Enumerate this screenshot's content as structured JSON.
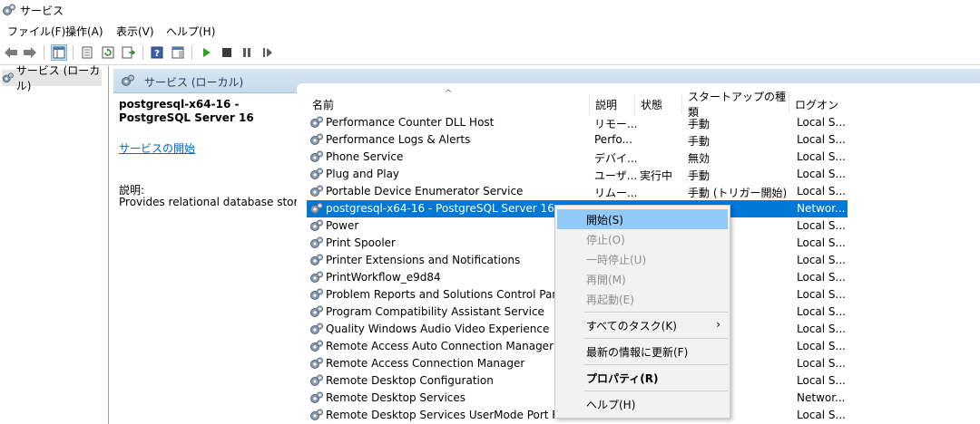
{
  "window": {
    "title": "サービス"
  },
  "menu": [
    {
      "label": "ファイル(F)"
    },
    {
      "label": "操作(A)"
    },
    {
      "label": "表示(V)"
    },
    {
      "label": "ヘルプ(H)"
    }
  ],
  "tree": {
    "item": "サービス (ローカル)"
  },
  "panel": {
    "header": "サービス (ローカル)"
  },
  "extended": {
    "service_title": "postgresql-x64-16 - PostgreSQL Server 16",
    "start_link": "サービスの開始",
    "description_label": "説明:",
    "description": "Provides relational database storage."
  },
  "columns": [
    {
      "label": "名前"
    },
    {
      "label": "説明"
    },
    {
      "label": "状態"
    },
    {
      "label": "スタートアップの種類"
    },
    {
      "label": "ログオン"
    }
  ],
  "rows": [
    {
      "name": "Performance Counter DLL Host",
      "desc": "リモー...",
      "status": "",
      "startup": "手動",
      "logon": "Local S..."
    },
    {
      "name": "Performance Logs & Alerts",
      "desc": "Perfo...",
      "status": "",
      "startup": "手動",
      "logon": "Local S..."
    },
    {
      "name": "Phone Service",
      "desc": "デバイ...",
      "status": "",
      "startup": "無効",
      "logon": "Local S..."
    },
    {
      "name": "Plug and Play",
      "desc": "ユーザ...",
      "status": "実行中",
      "startup": "手動",
      "logon": "Local S..."
    },
    {
      "name": "Portable Device Enumerator Service",
      "desc": "リムー...",
      "status": "",
      "startup": "手動 (トリガー開始)",
      "logon": "Local S..."
    },
    {
      "name": "postgresql-x64-16 - PostgreSQL Server 16",
      "desc": "",
      "status": "",
      "startup": "",
      "logon": "Networ...",
      "selected": true
    },
    {
      "name": "Power",
      "desc": "",
      "status": "",
      "startup": "",
      "logon": "Local S..."
    },
    {
      "name": "Print Spooler",
      "desc": "",
      "status": "",
      "startup": "",
      "logon": "Local S..."
    },
    {
      "name": "Printer Extensions and Notifications",
      "desc": "",
      "status": "",
      "startup": "",
      "logon": "Local S..."
    },
    {
      "name": "PrintWorkflow_e9d84",
      "desc": "",
      "status": "",
      "startup": "",
      "logon": "Local S..."
    },
    {
      "name": "Problem Reports and Solutions Control Panel Su",
      "desc": "",
      "status": "",
      "startup": "",
      "logon": "Local S..."
    },
    {
      "name": "Program Compatibility Assistant Service",
      "desc": "",
      "status": "",
      "startup": "",
      "logon": "Local S..."
    },
    {
      "name": "Quality Windows Audio Video Experience",
      "desc": "",
      "status": "",
      "startup": "",
      "logon": "Local S..."
    },
    {
      "name": "Remote Access Auto Connection Manager",
      "desc": "",
      "status": "",
      "startup": "",
      "logon": "Local S..."
    },
    {
      "name": "Remote Access Connection Manager",
      "desc": "",
      "status": "",
      "startup": "",
      "logon": "Local S..."
    },
    {
      "name": "Remote Desktop Configuration",
      "desc": "",
      "status": "",
      "startup": "",
      "logon": "Local S..."
    },
    {
      "name": "Remote Desktop Services",
      "desc": "",
      "status": "",
      "startup": "",
      "logon": "Networ..."
    },
    {
      "name": "Remote Desktop Services UserMode Port Redirector",
      "desc": "",
      "status": "",
      "startup": "",
      "logon": "Local S..."
    }
  ],
  "context_menu": {
    "start": "開始(S)",
    "stop": "停止(O)",
    "pause": "一時停止(U)",
    "resume": "再開(M)",
    "restart": "再起動(E)",
    "all_tasks": "すべてのタスク(K)",
    "refresh": "最新の情報に更新(F)",
    "properties": "プロパティ(R)",
    "help": "ヘルプ(H)"
  },
  "icons": {
    "app": "services-gear-icon",
    "back": "back-arrow-icon",
    "forward": "forward-arrow-icon",
    "play": "play-icon",
    "stop": "stop-icon",
    "pause": "pause-icon",
    "restart": "restart-icon"
  },
  "colors": {
    "selection": "#0078d7",
    "menu_highlight": "#91c9f7",
    "header_bg": "#c7d9ea",
    "link": "#0066cc"
  }
}
